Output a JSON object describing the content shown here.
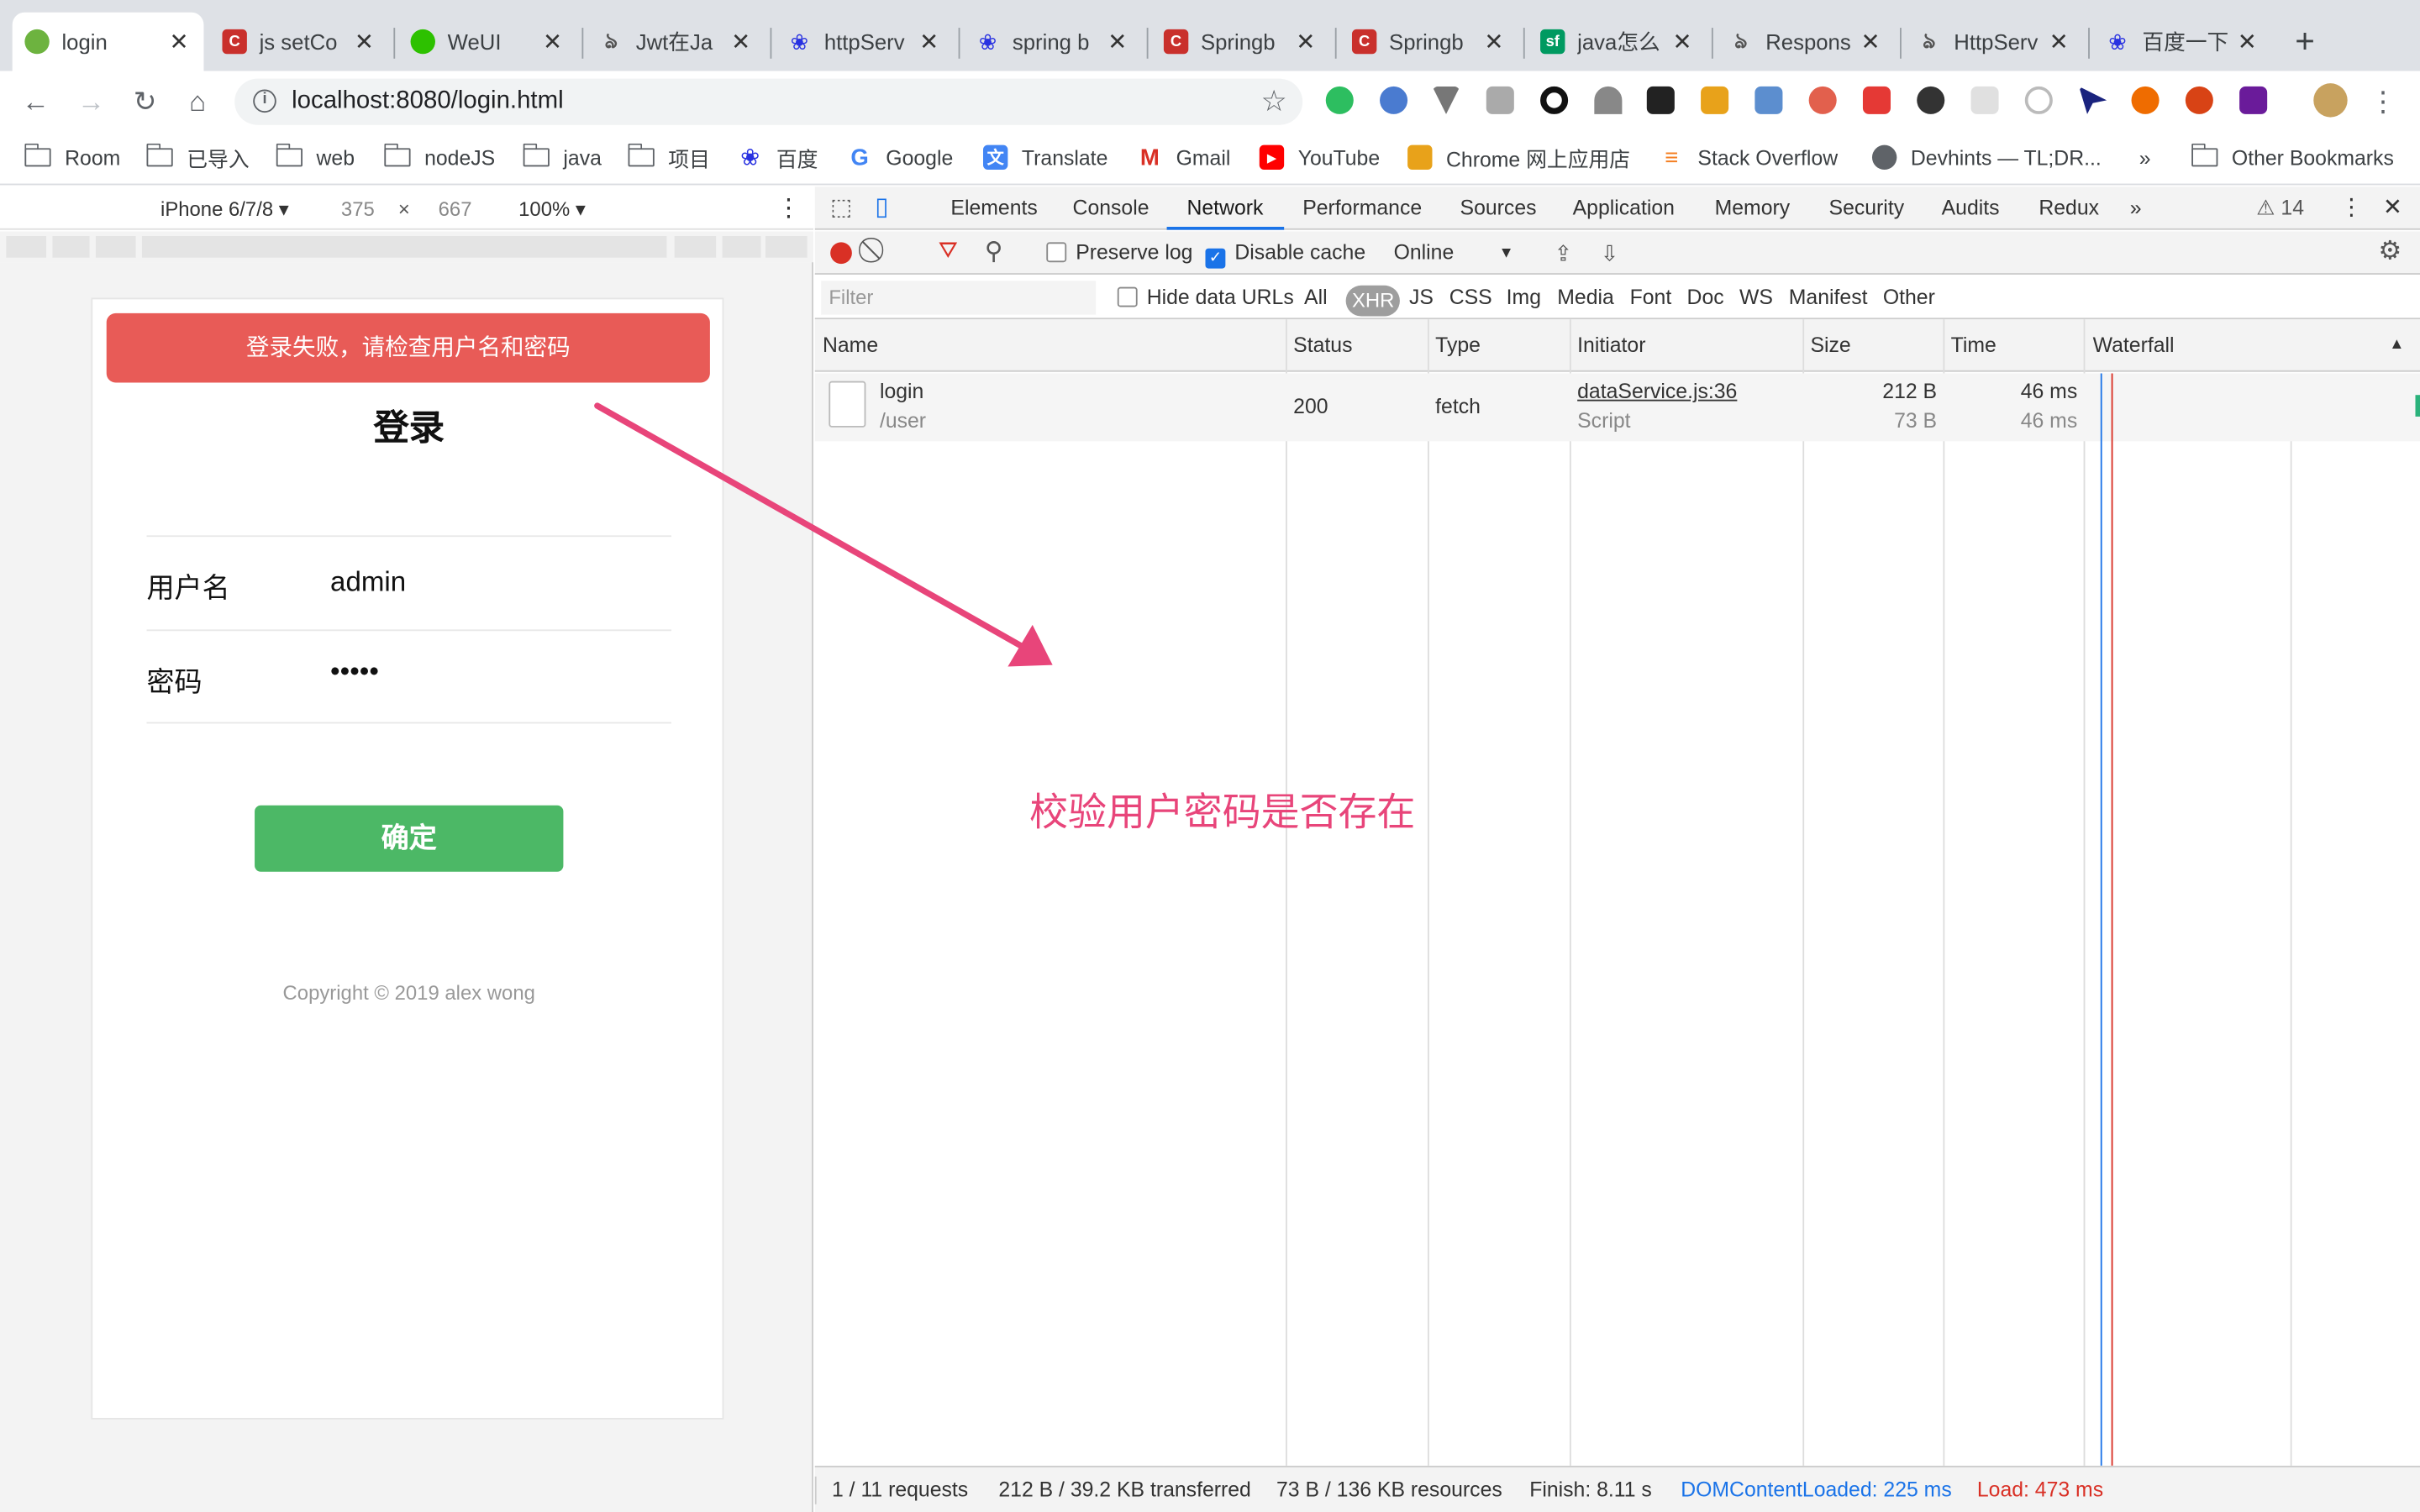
{
  "tabs": [
    {
      "title": "login",
      "favicon": "spring-leaf-icon",
      "color": "#6db33f"
    },
    {
      "title": "js setCo",
      "favicon": "csdn-icon",
      "color": "#c9302c"
    },
    {
      "title": "WeUI",
      "favicon": "wechat-icon",
      "color": "#2dc100"
    },
    {
      "title": "Jwt在Ja",
      "favicon": "segment-icon",
      "color": "#555555"
    },
    {
      "title": "httpServ",
      "favicon": "baidu-paw-icon",
      "color": "#2932e1"
    },
    {
      "title": "spring b",
      "favicon": "baidu-paw-icon",
      "color": "#2932e1"
    },
    {
      "title": "Springb",
      "favicon": "csdn-icon",
      "color": "#c9302c"
    },
    {
      "title": "Springb",
      "favicon": "csdn-icon",
      "color": "#c9302c"
    },
    {
      "title": "java怎么",
      "favicon": "segmentfault-icon",
      "color": "#009a61"
    },
    {
      "title": "Respons",
      "favicon": "segment-icon",
      "color": "#555555"
    },
    {
      "title": "HttpServ",
      "favicon": "segment-icon",
      "color": "#555555"
    },
    {
      "title": "百度一下",
      "favicon": "baidu-paw-icon",
      "color": "#2932e1"
    }
  ],
  "address": {
    "url": "localhost:8080/login.html"
  },
  "bookmarks": [
    {
      "label": "Room",
      "icon": "folder-icon"
    },
    {
      "label": "已导入",
      "icon": "folder-icon"
    },
    {
      "label": "web",
      "icon": "folder-icon"
    },
    {
      "label": "nodeJS",
      "icon": "folder-icon"
    },
    {
      "label": "java",
      "icon": "folder-icon"
    },
    {
      "label": "项目",
      "icon": "folder-icon"
    },
    {
      "label": "百度",
      "icon": "baidu-icon"
    },
    {
      "label": "Google",
      "icon": "google-icon"
    },
    {
      "label": "Translate",
      "icon": "translate-icon"
    },
    {
      "label": "Gmail",
      "icon": "gmail-icon"
    },
    {
      "label": "YouTube",
      "icon": "youtube-icon"
    },
    {
      "label": "Chrome 网上应用店",
      "icon": "webstore-icon"
    },
    {
      "label": "Stack Overflow",
      "icon": "stackoverflow-icon"
    },
    {
      "label": "Devhints — TL;DR...",
      "icon": "globe-icon"
    },
    {
      "label": "»",
      "icon": ""
    },
    {
      "label": "Other Bookmarks",
      "icon": "folder-icon"
    }
  ],
  "device": {
    "name": "iPhone 6/7/8 ▾",
    "width": "375",
    "times": "×",
    "height": "667",
    "zoom": "100% ▾"
  },
  "phone": {
    "error": "登录失败，请检查用户名和密码",
    "title": "登录",
    "username_label": "用户名",
    "username_value": "admin",
    "password_label": "密码",
    "password_value": "•••••",
    "submit": "确定",
    "copyright": "Copyright © 2019 alex wong"
  },
  "devtools": {
    "tabs": [
      "Elements",
      "Console",
      "Network",
      "Performance",
      "Sources",
      "Application",
      "Memory",
      "Security",
      "Audits",
      "Redux"
    ],
    "more": "»",
    "warnings": "⚠ 14",
    "controls": {
      "preserve_log": "Preserve log",
      "disable_cache": "Disable cache",
      "throttle": "Online"
    },
    "filter": {
      "placeholder": "Filter",
      "hide_data_urls": "Hide data URLs",
      "types": [
        "All",
        "XHR",
        "JS",
        "CSS",
        "Img",
        "Media",
        "Font",
        "Doc",
        "WS",
        "Manifest",
        "Other"
      ]
    },
    "columns": [
      "Name",
      "Status",
      "Type",
      "Initiator",
      "Size",
      "Time",
      "Waterfall"
    ],
    "rows": [
      {
        "name": "login",
        "path": "/user",
        "status": "200",
        "type": "fetch",
        "initiator": "dataService.js:36",
        "initiator_type": "Script",
        "size": "212 B",
        "resource_size": "73 B",
        "time": "46 ms",
        "latency": "46 ms"
      }
    ],
    "status_bar": {
      "requests": "1 / 11 requests",
      "transferred": "212 B / 39.2 KB transferred",
      "resources": "73 B / 136 KB resources",
      "finish": "Finish: 8.11 s",
      "dom": "DOMContentLoaded: 225 ms",
      "load": "Load: 473 ms"
    }
  },
  "annotation": {
    "text": "校验用户密码是否存在",
    "color": "#e8457a"
  }
}
